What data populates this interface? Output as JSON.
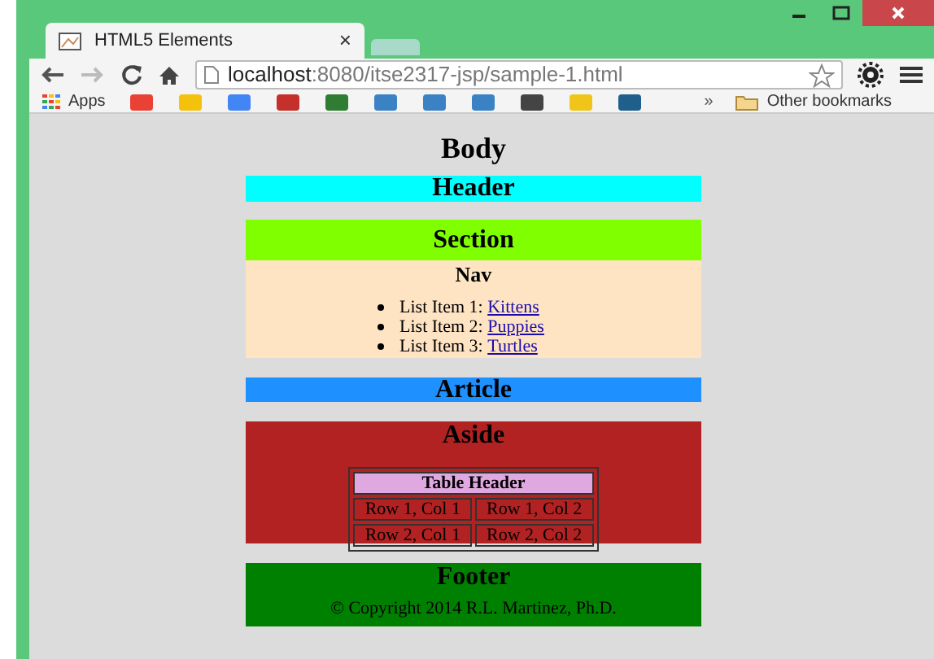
{
  "browser": {
    "tab_title": "HTML5 Elements",
    "tab_close": "×",
    "url_host": "localhost",
    "url_path": ":8080/itse2317-jsp/sample-1.html",
    "bookmarks_apps": "Apps",
    "bookmarks_more": "»",
    "other_bookmarks": "Other bookmarks"
  },
  "page": {
    "body_heading": "Body",
    "header": "Header",
    "section": "Section",
    "nav": {
      "heading": "Nav",
      "items": [
        {
          "prefix": "List Item 1: ",
          "link": "Kittens"
        },
        {
          "prefix": "List Item 2: ",
          "link": "Puppies"
        },
        {
          "prefix": "List Item 3: ",
          "link": "Turtles"
        }
      ]
    },
    "article": "Article",
    "aside": {
      "heading": "Aside",
      "table": {
        "header": "Table Header",
        "rows": [
          [
            "Row 1, Col 1",
            "Row 1, Col 2"
          ],
          [
            "Row 2, Col 1",
            "Row 2, Col 2"
          ]
        ]
      }
    },
    "footer": {
      "heading": "Footer",
      "copyright": "© Copyright 2014 R.L. Martinez, Ph.D."
    }
  }
}
